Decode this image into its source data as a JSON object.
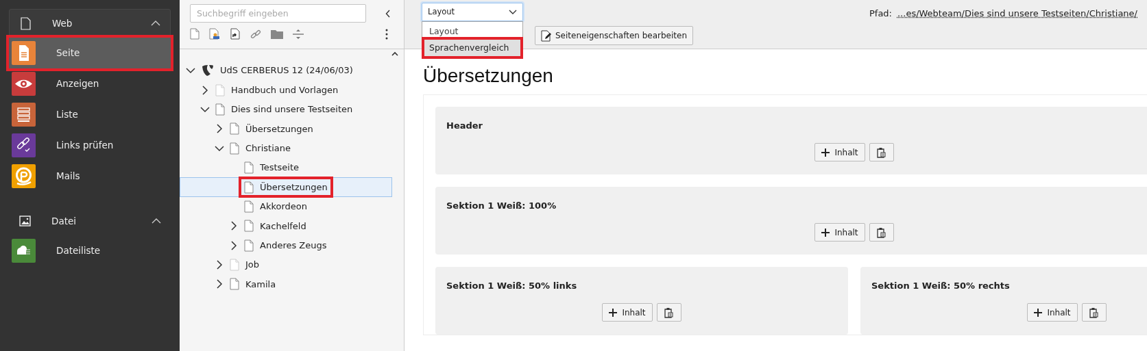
{
  "sidebar": {
    "groups": [
      {
        "label": "Web",
        "expanded": true,
        "items": [
          {
            "label": "Seite",
            "color": "#e8843a",
            "selected": true,
            "highlighted": true
          },
          {
            "label": "Anzeigen",
            "color": "#c83c3c",
            "selected": false,
            "highlighted": false
          },
          {
            "label": "Liste",
            "color": "#c8643a",
            "selected": false,
            "highlighted": false
          },
          {
            "label": "Links prüfen",
            "color": "#6a3a9a",
            "selected": false,
            "highlighted": false
          },
          {
            "label": "Mails",
            "color": "#f0a000",
            "selected": false,
            "highlighted": false
          }
        ]
      },
      {
        "label": "Datei",
        "expanded": true,
        "items": [
          {
            "label": "Dateiliste",
            "color": "#4a8a3a",
            "selected": false,
            "highlighted": false
          }
        ]
      }
    ]
  },
  "page_tree": {
    "search": {
      "placeholder": "Suchbegriff eingeben"
    },
    "nodes": [
      {
        "label": "UdS CERBERUS 12 (24/06/03)",
        "kind": "site",
        "expandable": true,
        "expanded": true,
        "dimmed": false,
        "selected": false,
        "highlighted": false,
        "children": [
          {
            "label": "Handbuch und Vorlagen",
            "kind": "page",
            "expandable": true,
            "expanded": false,
            "dimmed": true,
            "selected": false,
            "highlighted": false
          },
          {
            "label": "Dies sind unsere Testseiten",
            "kind": "page",
            "expandable": true,
            "expanded": true,
            "dimmed": false,
            "selected": false,
            "highlighted": false,
            "children": [
              {
                "label": "Übersetzungen",
                "kind": "page",
                "expandable": true,
                "expanded": false,
                "dimmed": false,
                "selected": false,
                "highlighted": false
              },
              {
                "label": "Christiane",
                "kind": "page",
                "expandable": true,
                "expanded": true,
                "dimmed": false,
                "selected": false,
                "highlighted": false,
                "children": [
                  {
                    "label": "Testseite",
                    "kind": "page",
                    "expandable": false,
                    "dimmed": false,
                    "selected": false,
                    "highlighted": false
                  },
                  {
                    "label": "Übersetzungen",
                    "kind": "page",
                    "expandable": false,
                    "dimmed": false,
                    "selected": true,
                    "highlighted": true
                  },
                  {
                    "label": "Akkordeon",
                    "kind": "page",
                    "expandable": false,
                    "dimmed": false,
                    "selected": false,
                    "highlighted": false
                  },
                  {
                    "label": "Kachelfeld",
                    "kind": "page",
                    "expandable": true,
                    "expanded": false,
                    "dimmed": false,
                    "selected": false,
                    "highlighted": false
                  },
                  {
                    "label": "Anderes Zeugs",
                    "kind": "page",
                    "expandable": true,
                    "expanded": false,
                    "dimmed": false,
                    "selected": false,
                    "highlighted": false
                  }
                ]
              },
              {
                "label": "Job",
                "kind": "page",
                "expandable": true,
                "expanded": false,
                "dimmed": true,
                "selected": false,
                "highlighted": false
              },
              {
                "label": "Kamila",
                "kind": "page",
                "expandable": true,
                "expanded": false,
                "dimmed": false,
                "selected": false,
                "highlighted": false
              }
            ]
          }
        ]
      }
    ]
  },
  "module": {
    "view_select": {
      "value": "Layout",
      "expanded": true,
      "options": [
        {
          "label": "Layout",
          "hovered": false,
          "highlighted": false
        },
        {
          "label": "Sprachenvergleich",
          "hovered": true,
          "highlighted": true
        }
      ]
    },
    "edit_button": "Seiteneigenschaften bearbeiten",
    "path": {
      "label": "Pfad:",
      "value": "...es/Webteam/Dies sind unsere Testseiten/Christiane/"
    },
    "title": "Übersetzungen",
    "sections": [
      {
        "title": "Header",
        "full_width": true,
        "add_button": "Inhalt"
      },
      {
        "title": "Sektion 1 Weiß: 100%",
        "full_width": true,
        "add_button": "Inhalt"
      },
      {
        "title": "Sektion 1 Weiß: 50% links",
        "full_width": false,
        "add_button": "Inhalt"
      },
      {
        "title": "Sektion 1 Weiß: 50% rechts",
        "full_width": false,
        "add_button": "Inhalt"
      }
    ]
  }
}
